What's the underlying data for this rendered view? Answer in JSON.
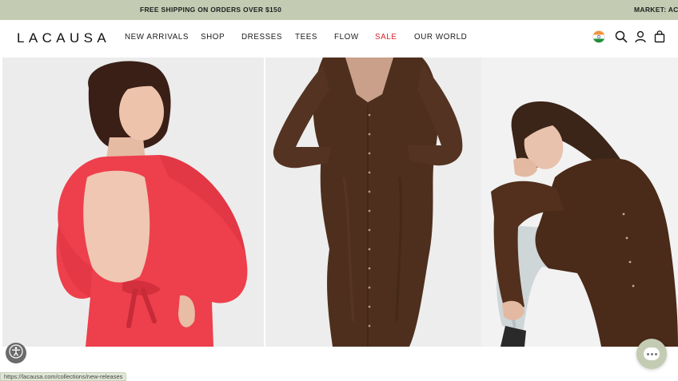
{
  "announcement": {
    "text": "FREE SHIPPING ON ORDERS OVER $150",
    "market": "MARKET: ACC"
  },
  "header": {
    "logo": "LACAUSA",
    "nav": [
      {
        "label": "NEW ARRIVALS"
      },
      {
        "label": "SHOP"
      },
      {
        "label": "DRESSES"
      },
      {
        "label": "TEES"
      },
      {
        "label": "FLOW"
      },
      {
        "label": "SALE"
      },
      {
        "label": "OUR WORLD"
      }
    ],
    "icons": [
      "india-flag-icon",
      "search-icon",
      "account-icon",
      "cart-icon"
    ]
  },
  "colors": {
    "announcement_bg": "#c3cbb2",
    "sale": "#d8232a",
    "red_dress": "#ee3f4c",
    "brown_dress": "#4e2f1e",
    "brown_jacket": "#4a2a18"
  },
  "hero": {
    "panels": [
      "red-dress-photo",
      "brown-dress-photo",
      "brown-jacket-photo"
    ]
  },
  "status_bar": {
    "url": "https://lacausa.com/collections/new-releases"
  }
}
